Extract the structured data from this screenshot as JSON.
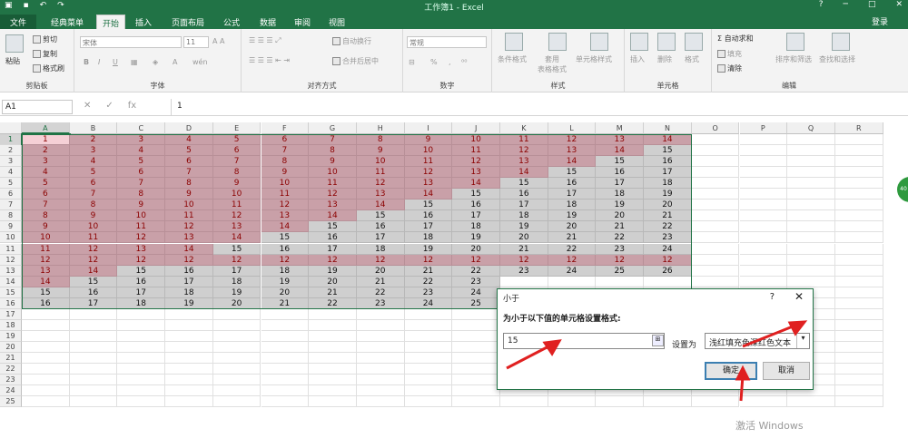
{
  "titlebar": {
    "title": "工作簿1 - Excel",
    "help": "?"
  },
  "tabs": {
    "file": "文件",
    "items": [
      "经典菜单",
      "开始",
      "插入",
      "页面布局",
      "公式",
      "数据",
      "审阅",
      "视图"
    ],
    "login": "登录"
  },
  "ribbon": {
    "clipboard": {
      "label": "剪贴板",
      "paste": "粘贴",
      "cut": "剪切",
      "copy": "复制",
      "format_painter": "格式刷"
    },
    "font": {
      "label": "字体",
      "name": "宋体",
      "size": "11",
      "bold": "B",
      "italic": "I",
      "underline": "U",
      "wen": "wén"
    },
    "alignment": {
      "label": "对齐方式",
      "wrap": "自动换行",
      "merge": "合并后居中"
    },
    "number": {
      "label": "数字",
      "format": "常规",
      "percent": "%",
      "comma": ","
    },
    "styles": {
      "label": "样式",
      "conditional": "条件格式",
      "table": "套用\n表格格式",
      "cell_styles": "单元格样式"
    },
    "cells": {
      "label": "单元格",
      "insert": "插入",
      "delete": "删除",
      "format": "格式"
    },
    "editing": {
      "label": "编辑",
      "autosum": "自动求和",
      "fill": "填充",
      "clear": "清除",
      "sort": "排序和筛选",
      "find": "查找和选择"
    }
  },
  "formula_bar": {
    "name_box": "A1",
    "value": "1"
  },
  "columns": [
    "A",
    "B",
    "C",
    "D",
    "E",
    "F",
    "G",
    "H",
    "I",
    "J",
    "K",
    "L",
    "M",
    "N",
    "O",
    "P",
    "Q",
    "R"
  ],
  "rows": [
    "1",
    "2",
    "3",
    "4",
    "5",
    "6",
    "7",
    "8",
    "9",
    "10",
    "11",
    "12",
    "13",
    "14",
    "15",
    "16",
    "17",
    "18",
    "19",
    "20",
    "21",
    "22",
    "23",
    "24",
    "25"
  ],
  "grid_values": [
    [
      "1",
      "2",
      "3",
      "4",
      "5",
      "6",
      "7",
      "8",
      "9",
      "10",
      "11",
      "12",
      "13",
      "14"
    ],
    [
      "2",
      "3",
      "4",
      "5",
      "6",
      "7",
      "8",
      "9",
      "10",
      "11",
      "12",
      "13",
      "14",
      "15"
    ],
    [
      "3",
      "4",
      "5",
      "6",
      "7",
      "8",
      "9",
      "10",
      "11",
      "12",
      "13",
      "14",
      "15",
      "16"
    ],
    [
      "4",
      "5",
      "6",
      "7",
      "8",
      "9",
      "10",
      "11",
      "12",
      "13",
      "14",
      "15",
      "16",
      "17"
    ],
    [
      "5",
      "6",
      "7",
      "8",
      "9",
      "10",
      "11",
      "12",
      "13",
      "14",
      "15",
      "16",
      "17",
      "18"
    ],
    [
      "6",
      "7",
      "8",
      "9",
      "10",
      "11",
      "12",
      "13",
      "14",
      "15",
      "16",
      "17",
      "18",
      "19"
    ],
    [
      "7",
      "8",
      "9",
      "10",
      "11",
      "12",
      "13",
      "14",
      "15",
      "16",
      "17",
      "18",
      "19",
      "20"
    ],
    [
      "8",
      "9",
      "10",
      "11",
      "12",
      "13",
      "14",
      "15",
      "16",
      "17",
      "18",
      "19",
      "20",
      "21"
    ],
    [
      "9",
      "10",
      "11",
      "12",
      "13",
      "14",
      "15",
      "16",
      "17",
      "18",
      "19",
      "20",
      "21",
      "22"
    ],
    [
      "10",
      "11",
      "12",
      "13",
      "14",
      "15",
      "16",
      "17",
      "18",
      "19",
      "20",
      "21",
      "22",
      "23"
    ],
    [
      "11",
      "12",
      "13",
      "14",
      "15",
      "16",
      "17",
      "18",
      "19",
      "20",
      "21",
      "22",
      "23",
      "24"
    ],
    [
      "12",
      "12",
      "12",
      "12",
      "12",
      "12",
      "12",
      "12",
      "12",
      "12",
      "12",
      "12",
      "12",
      "12"
    ],
    [
      "13",
      "14",
      "15",
      "16",
      "17",
      "18",
      "19",
      "20",
      "21",
      "22",
      "23",
      "24",
      "25",
      "26"
    ],
    [
      "14",
      "15",
      "16",
      "17",
      "18",
      "19",
      "20",
      "21",
      "22",
      "23",
      "",
      "",
      "",
      ""
    ],
    [
      "15",
      "16",
      "17",
      "18",
      "19",
      "20",
      "21",
      "22",
      "23",
      "24",
      "",
      "",
      "",
      ""
    ],
    [
      "16",
      "17",
      "18",
      "19",
      "20",
      "21",
      "22",
      "23",
      "24",
      "25",
      "",
      "",
      "",
      ""
    ]
  ],
  "highlight": {
    "threshold": 15,
    "red_bg": "#c9a0a8",
    "red_text": "#8b0000",
    "gray_bg": "#cfcfcf",
    "accent": "#217346"
  },
  "dialog": {
    "title": "小于",
    "help": "?",
    "close": "✕",
    "prompt": "为小于以下值的单元格设置格式:",
    "value": "15",
    "set_label": "设置为",
    "format_option": "浅红填充色深红色文本",
    "ok": "确定",
    "cancel": "取消"
  },
  "watermark": "激活 Windows",
  "side_badge": "40"
}
